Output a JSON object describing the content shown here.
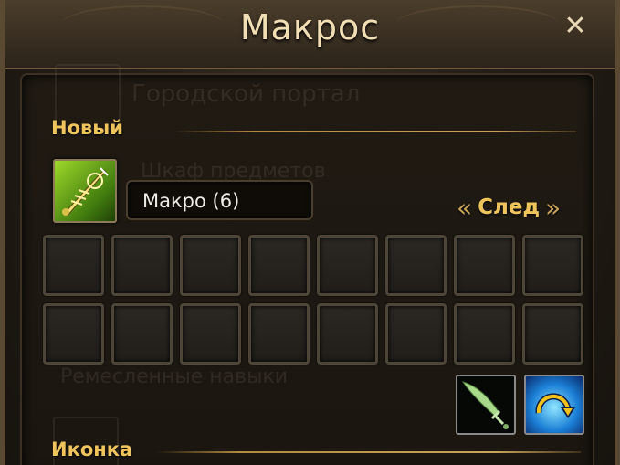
{
  "window": {
    "title": "Макрос",
    "close_label": "✕"
  },
  "background_ghost": {
    "line1": "Городской портал",
    "line2": "Шкаф предметов",
    "line3": "Ремесленные навыки"
  },
  "new_section": {
    "label": "Новый",
    "macro_icon": "sword-scroll-icon",
    "macro_name_value": "Макро (6)",
    "next_label": "След",
    "prev_chevron": "«",
    "next_chevron": "»"
  },
  "command_slots": {
    "rows": 2,
    "columns": 8
  },
  "skill_icons": [
    {
      "name": "green-sword-icon"
    },
    {
      "name": "blue-swap-arrow-icon"
    }
  ],
  "icon_section": {
    "label": "Иконка"
  },
  "colors": {
    "title_text": "#f2dfb4",
    "section_label": "#f0c45c",
    "divider": "#c9a45a",
    "frame": "#5a4a33"
  }
}
